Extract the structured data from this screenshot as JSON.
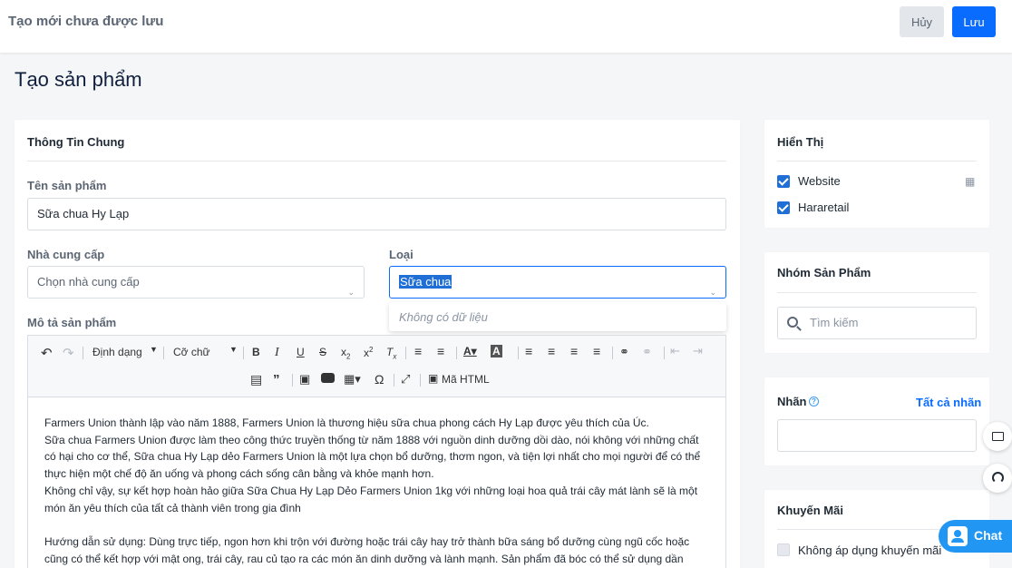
{
  "header": {
    "title": "Tạo mới chưa được lưu",
    "cancel_label": "Hủy",
    "save_label": "Lưu"
  },
  "page_title": "Tạo sản phẩm",
  "general": {
    "section_title": "Thông Tin Chung",
    "name_label": "Tên sản phẩm",
    "name_value": "Sữa chua Hy Lạp",
    "supplier_label": "Nhà cung cấp",
    "supplier_placeholder": "Chọn nhà cung cấp",
    "type_label": "Loại",
    "type_value": "Sữa chua",
    "type_dropdown_empty": "Không có dữ liệu",
    "description_label": "Mô tả sản phẩm"
  },
  "editor": {
    "format_label": "Định dạng",
    "font_size_label": "Cỡ chữ",
    "html_label": "Mã HTML",
    "icons": [
      "undo-icon",
      "redo-icon",
      "bold-icon",
      "italic-icon",
      "underline-icon",
      "strikethrough-icon",
      "subscript-icon",
      "superscript-icon",
      "clear-format-icon",
      "ordered-list-icon",
      "unordered-list-icon",
      "text-color-icon",
      "background-color-icon",
      "align-left-icon",
      "align-center-icon",
      "align-right-icon",
      "align-justify-icon",
      "link-icon",
      "unlink-icon",
      "outdent-icon",
      "indent-icon",
      "horizontal-rule-icon",
      "quote-icon",
      "image-icon",
      "video-icon",
      "table-icon",
      "special-char-icon",
      "fullscreen-icon",
      "html-code-icon"
    ],
    "paragraphs": [
      "Farmers Union thành lập vào năm 1888, Farmers Union là thương hiệu sữa chua phong cách Hy Lạp được yêu thích của Úc.",
      "Sữa chua Farmers Union được làm theo công thức truyền thống từ năm 1888 với nguồn dinh dưỡng dồi dào, nói không với những chất có hại cho cơ thể, Sữa chua Hy Lạp dẻo Farmers Union là một lựa chọn bổ dưỡng, thơm ngon, và tiện lợi nhất cho mọi người để có thể thực hiện một chế độ ăn uống và phong cách sống cân bằng và khỏe mạnh hơn.",
      "Không chỉ vậy, sự kết hợp hoàn hảo giữa Sữa Chua Hy Lạp Dẻo Farmers Union 1kg với những loại hoa quả trái cây mát lành sẽ là một món ăn yêu thích của tất cả thành viên trong gia đình",
      "Hướng dẫn sử dụng: Dùng trực tiếp, ngon hơn khi trộn với đường hoặc trái cây hay trở thành bữa sáng bổ dưỡng cùng ngũ cốc hoặc cũng có thể kết hợp với mật ong, trái cây, rau củ tạo ra các món ăn dinh dưỡng và lành mạnh. Sản phẩm đã bóc có thể sử dụng dần trong ngăn"
    ]
  },
  "display": {
    "title": "Hiển Thị",
    "channels": [
      {
        "label": "Website",
        "checked": true
      },
      {
        "label": "Hararetail",
        "checked": true
      }
    ]
  },
  "group": {
    "title": "Nhóm Sản Phẩm",
    "search_placeholder": "Tìm kiếm"
  },
  "tags": {
    "title": "Nhãn",
    "all_link": "Tất cả nhãn"
  },
  "promotion": {
    "title": "Khuyến Mãi",
    "option_label": "Không áp dụng khuyến mãi"
  },
  "chat": {
    "label": "Chat"
  },
  "colors": {
    "primary": "#0a6cff",
    "checkbox": "#1f6fd6",
    "chat": "#2196f3"
  }
}
